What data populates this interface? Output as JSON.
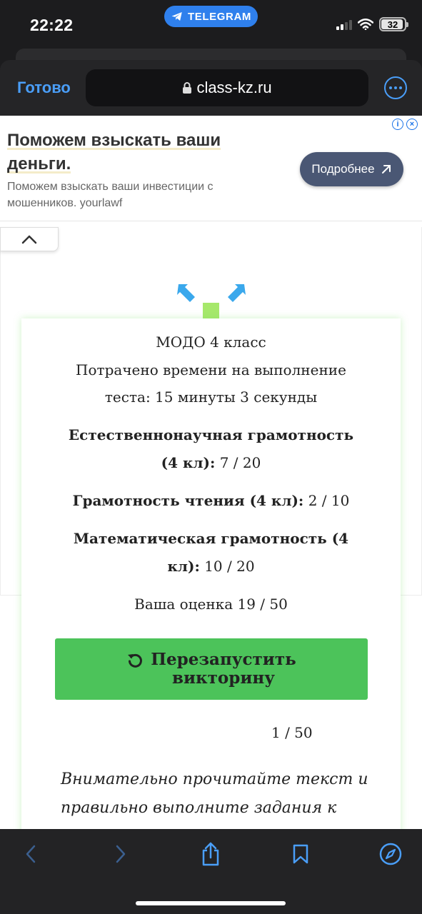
{
  "status_bar": {
    "time": "22:22",
    "telegram_label": "TELEGRAM",
    "battery": "32"
  },
  "browser": {
    "done_label": "Готово",
    "url": "class-kz.ru"
  },
  "ad": {
    "title_line1": "Поможем взыскать ваши",
    "title_line2": "деньги.",
    "text": "Поможем взыскать ваши инвестиции с мошенников. yourlawf",
    "button_label": "Подробнее"
  },
  "quiz": {
    "title": "МОДО 4 класс",
    "time_line1": "Потрачено времени на выполнение",
    "time_line2": "теста: 15 минуты 3 секунды",
    "sections": [
      {
        "name_line1": "Естественнонаучная грамотность",
        "name_line2": "(4 кл):",
        "score": "7 / 20"
      },
      {
        "name": "Грамотность чтения (4 кл):",
        "score": "2 / 10"
      },
      {
        "name_line1": "Математическая грамотность (4",
        "name_line2": "кл):",
        "score": "10 / 20"
      }
    ],
    "total": "Ваша оценка 19 / 50",
    "restart_line1": "Перезапустить",
    "restart_line2": "викторину",
    "counter": "1 / 50",
    "instruction_line1": "Внимательно прочитайте текст и",
    "instruction_line2": "правильно выполните задания к"
  },
  "colors": {
    "accent_blue": "#4a9ef8",
    "restart_green": "#4cc35a",
    "telegram": "#2f80ed",
    "ad_button": "#4a5774"
  }
}
